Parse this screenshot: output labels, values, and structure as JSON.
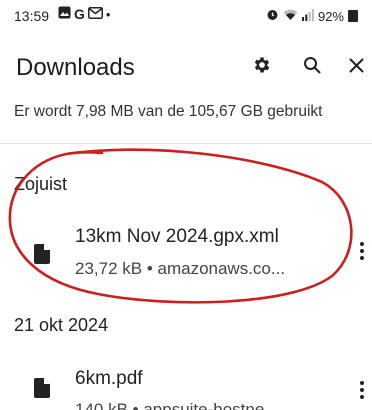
{
  "status_bar": {
    "time": "13:59",
    "letter_g": "G",
    "dot": "•",
    "battery": "92%",
    "icons_left": [
      "gallery-icon",
      "google-icon",
      "gmail-icon"
    ],
    "icons_right": [
      "alarm-icon",
      "wifi-icon",
      "signal-icon",
      "battery-icon"
    ]
  },
  "header": {
    "title": "Downloads",
    "actions": [
      "settings-icon",
      "search-icon",
      "close-icon"
    ]
  },
  "storage_info": "Er wordt 7,98 MB van de 105,67 GB gebruikt",
  "sections": [
    {
      "title": "Zojuist",
      "items": [
        {
          "name": "13km Nov 2024.gpx.xml",
          "meta": "23,72 kB • amazonaws.co..."
        }
      ]
    },
    {
      "title": "21 okt 2024",
      "items": [
        {
          "name": "6km.pdf",
          "meta": "140 kB • appsuite-hostne..."
        }
      ]
    }
  ],
  "colors": {
    "annotation_circle": "#cc1f1f",
    "text": "#1c1c1c",
    "divider": "#e2e2e2"
  }
}
